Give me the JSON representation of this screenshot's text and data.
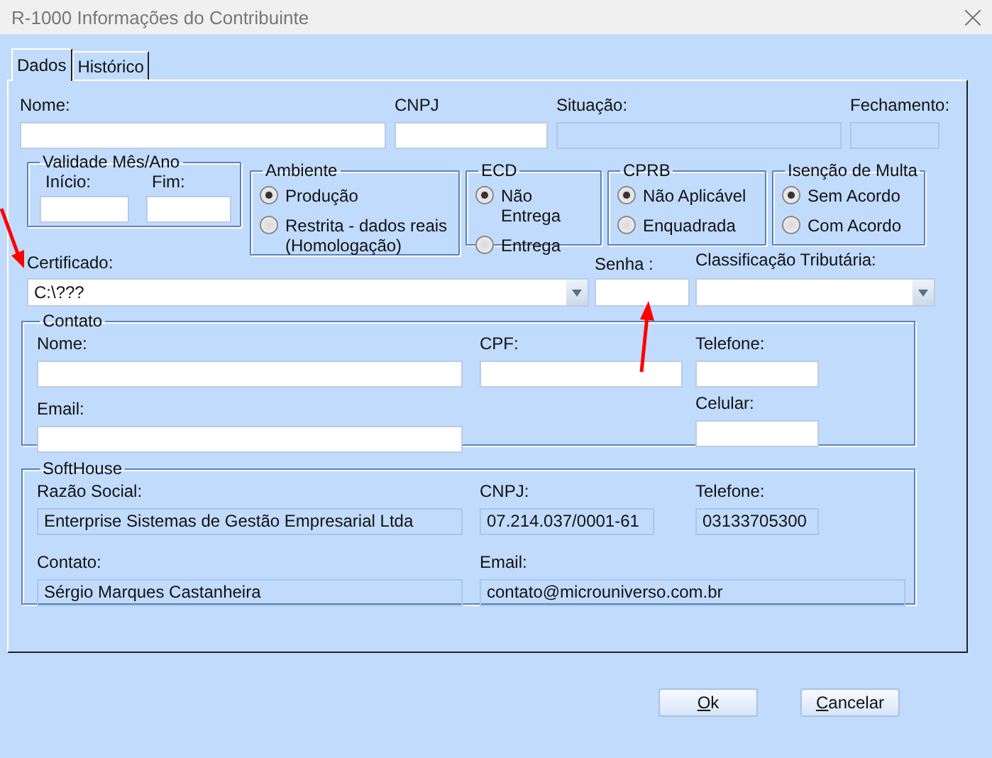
{
  "window": {
    "title": "R-1000 Informações do Contribuinte"
  },
  "tabs": [
    {
      "label": "Dados",
      "selected": true
    },
    {
      "label": "Histórico",
      "selected": false
    }
  ],
  "header_fields": [
    {
      "label": "Nome:",
      "disabled": false
    },
    {
      "label": "CNPJ",
      "disabled": false
    },
    {
      "label": "Situação:",
      "disabled": true
    },
    {
      "label": "Fechamento:",
      "disabled": true
    }
  ],
  "validade": {
    "title": "Validade Mês/Ano",
    "fields": [
      {
        "label": "Início:"
      },
      {
        "label": "Fim:"
      }
    ]
  },
  "radio_groups": [
    {
      "title": "Ambiente",
      "options": [
        {
          "label": "Produção",
          "selected": true
        },
        {
          "label": "Restrita - dados reais (Homologação)",
          "selected": false
        }
      ]
    },
    {
      "title": "ECD",
      "options": [
        {
          "label": "Não Entrega",
          "selected": true
        },
        {
          "label": "Entrega",
          "selected": false
        }
      ]
    },
    {
      "title": "CPRB",
      "options": [
        {
          "label": "Não Aplicável",
          "selected": true
        },
        {
          "label": "Enquadrada",
          "selected": false
        }
      ]
    },
    {
      "title": "Isenção de Multa",
      "options": [
        {
          "label": "Sem Acordo",
          "selected": true
        },
        {
          "label": "Com Acordo",
          "selected": false
        }
      ]
    }
  ],
  "certificado": {
    "label": "Certificado:",
    "value": "C:\\???"
  },
  "senha": {
    "label": "Senha :"
  },
  "classificacao": {
    "label": "Classificação Tributária:"
  },
  "contato": {
    "title": "Contato",
    "columns": [
      [
        {
          "label": "Nome:"
        },
        {
          "label": "Email:"
        }
      ],
      [
        {
          "label": "CPF:"
        }
      ],
      [
        {
          "label": "Telefone:"
        },
        {
          "label": "Celular:"
        }
      ]
    ]
  },
  "softhouse": {
    "title": "SoftHouse",
    "rows": [
      [
        {
          "label": "Razão Social:",
          "value": "Enterprise Sistemas de Gestão Empresarial Ltda"
        },
        {
          "label": "CNPJ:",
          "value": "07.214.037/0001-61"
        },
        {
          "label": "Telefone:",
          "value": "03133705300"
        }
      ],
      [
        {
          "label": "Contato:",
          "value": "Sérgio Marques Castanheira"
        },
        {
          "label": "Email:",
          "value": "contato@microuniverso.com.br"
        }
      ]
    ]
  },
  "buttons": [
    {
      "label": "Ok"
    },
    {
      "label": "Cancelar"
    }
  ]
}
